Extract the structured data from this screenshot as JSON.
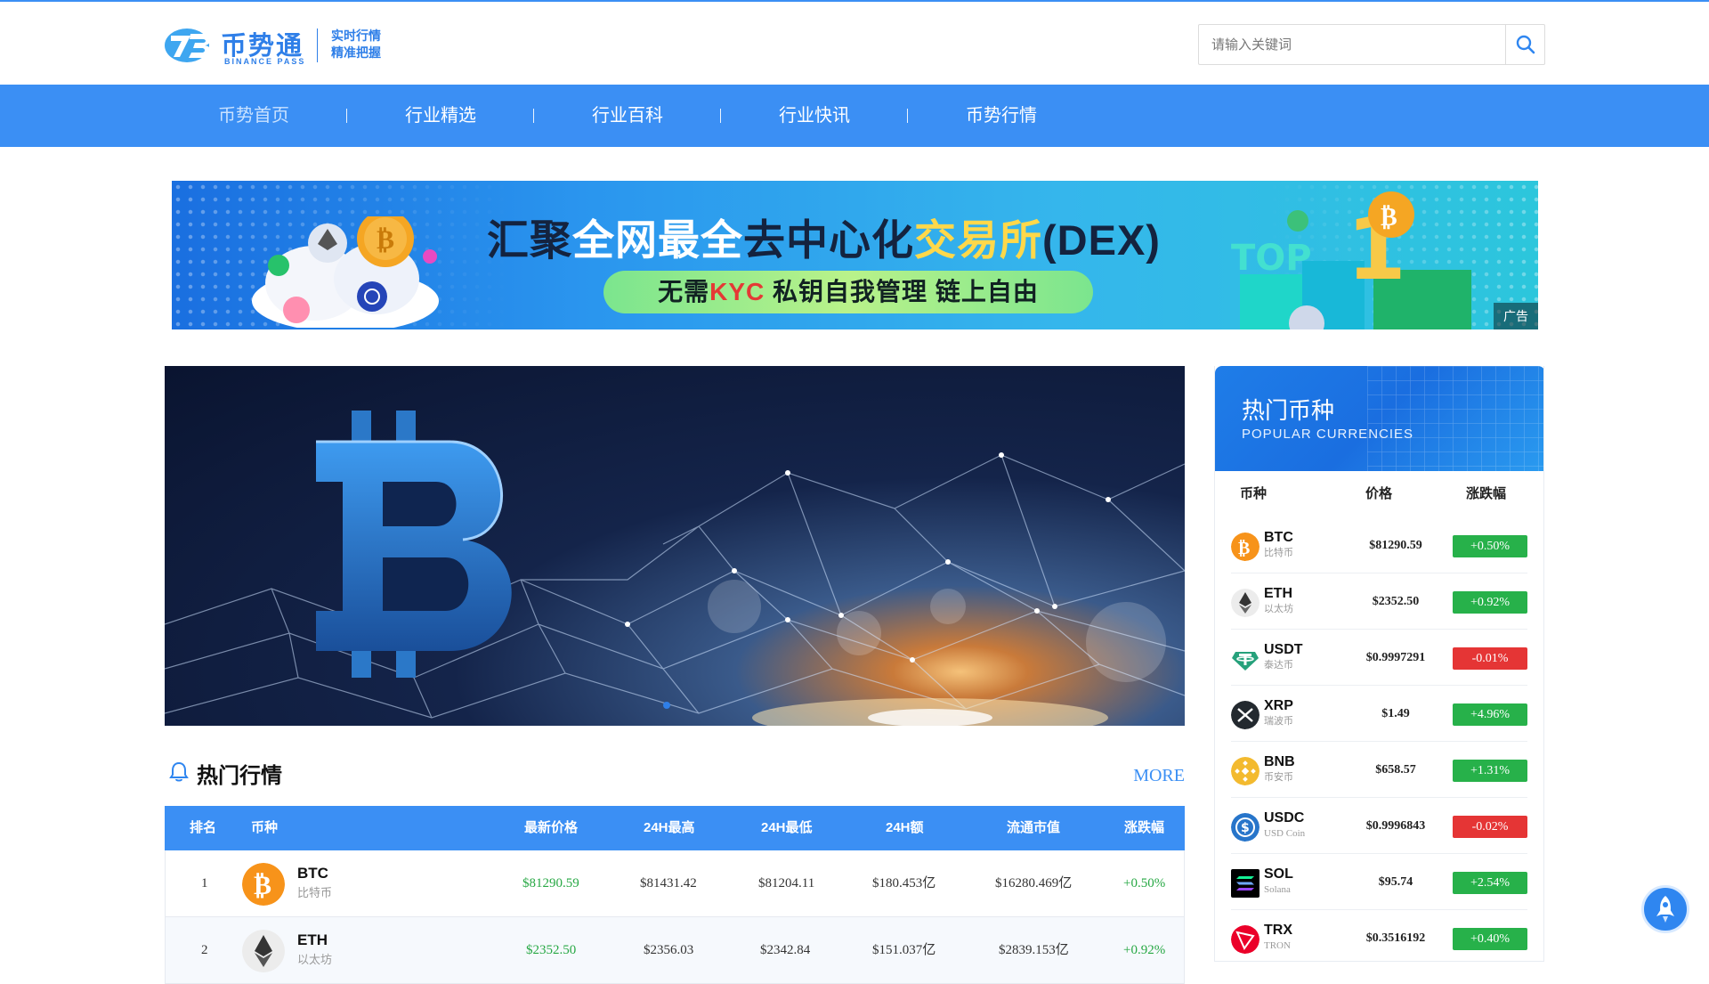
{
  "brand": {
    "name_cn": "币势通",
    "name_en": "BINANCE PASS",
    "slogan_line1": "实时行情",
    "slogan_line2": "精准把握",
    "accent": "#3b8ff4"
  },
  "search": {
    "placeholder": "请输入关键词",
    "icon": "search-icon"
  },
  "nav": {
    "items": [
      {
        "label": "币势首页",
        "active": true
      },
      {
        "label": "行业精选"
      },
      {
        "label": "行业百科"
      },
      {
        "label": "行业快讯"
      },
      {
        "label": "币势行情"
      }
    ]
  },
  "ad": {
    "title_prefix": "汇聚",
    "title_hl1": "全网最全",
    "title_mid": "去中心化",
    "title_hl2": "交易所",
    "title_suffix": "(DEX)",
    "sub_prefix": "无需",
    "sub_kyc": "KYC",
    "sub_suffix": " 私钥自我管理 链上自由",
    "tag": "广告",
    "badge_top": "TOP",
    "badge_num": "1"
  },
  "hot": {
    "title": "热门行情",
    "more": "MORE",
    "icon": "bell-icon",
    "columns": [
      "排名",
      "币种",
      "最新价格",
      "24H最高",
      "24H最低",
      "24H额",
      "流通市值",
      "涨跌幅"
    ],
    "rows": [
      {
        "rank": "1",
        "symbol": "BTC",
        "name": "比特币",
        "price": "$81290.59",
        "high": "$81431.42",
        "low": "$81204.11",
        "volume": "$180.453亿",
        "mcap": "$16280.469亿",
        "change": "+0.50%",
        "trend": "up",
        "icon": "btc-icon"
      },
      {
        "rank": "2",
        "symbol": "ETH",
        "name": "以太坊",
        "price": "$2352.50",
        "high": "$2356.03",
        "low": "$2342.84",
        "volume": "$151.037亿",
        "mcap": "$2839.153亿",
        "change": "+0.92%",
        "trend": "up",
        "icon": "eth-icon"
      }
    ]
  },
  "popular": {
    "title": "热门币种",
    "subtitle": "POPULAR CURRENCIES",
    "columns": [
      "币种",
      "价格",
      "涨跌幅"
    ],
    "rows": [
      {
        "symbol": "BTC",
        "name": "比特币",
        "price": "$81290.59",
        "change": "+0.50%",
        "trend": "up",
        "icon": "btc-icon",
        "color": "#f7931a"
      },
      {
        "symbol": "ETH",
        "name": "以太坊",
        "price": "$2352.50",
        "change": "+0.92%",
        "trend": "up",
        "icon": "eth-icon",
        "color": "#ececec"
      },
      {
        "symbol": "USDT",
        "name": "泰达币",
        "price": "$0.9997291",
        "change": "-0.01%",
        "trend": "down",
        "icon": "usdt-icon",
        "color": "#26a17b"
      },
      {
        "symbol": "XRP",
        "name": "瑞波币",
        "price": "$1.49",
        "change": "+4.96%",
        "trend": "up",
        "icon": "xrp-icon",
        "color": "#23292f"
      },
      {
        "symbol": "BNB",
        "name": "币安币",
        "price": "$658.57",
        "change": "+1.31%",
        "trend": "up",
        "icon": "bnb-icon",
        "color": "#f3ba2f"
      },
      {
        "symbol": "USDC",
        "name": "USD Coin",
        "price": "$0.9996843",
        "change": "-0.02%",
        "trend": "down",
        "icon": "usdc-icon",
        "color": "#2775ca"
      },
      {
        "symbol": "SOL",
        "name": "Solana",
        "price": "$95.74",
        "change": "+2.54%",
        "trend": "up",
        "icon": "sol-icon",
        "color": "#000000"
      },
      {
        "symbol": "TRX",
        "name": "TRON",
        "price": "$0.3516192",
        "change": "+0.40%",
        "trend": "up",
        "icon": "trx-icon",
        "color": "#eb0029"
      }
    ]
  },
  "back_to_top": {
    "icon": "rocket-icon"
  }
}
